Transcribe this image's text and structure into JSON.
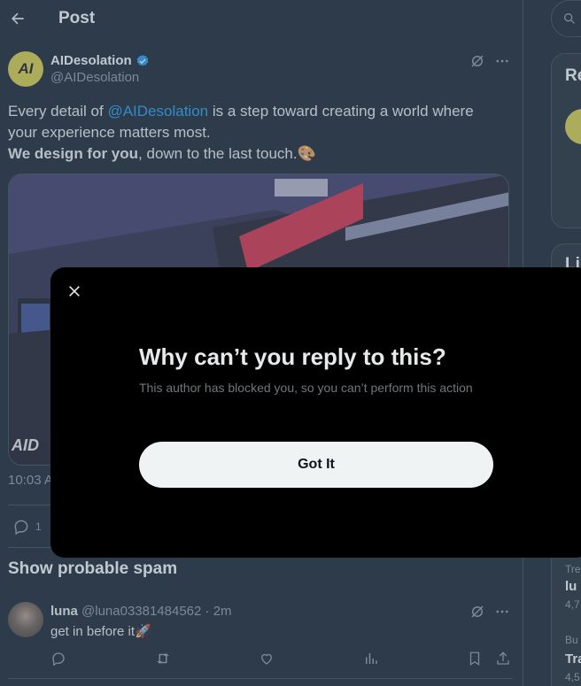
{
  "header": {
    "title": "Post"
  },
  "post": {
    "display_name": "AIDesolation",
    "handle": "@AIDesolation",
    "avatar_text": "AI",
    "text_prefix": "Every detail of ",
    "mention": "@AIDesolation",
    "text_middle": "  is a step toward creating a world where your experience matters most.",
    "bold_text": "We design for you",
    "text_suffix": ", down to the last touch.🎨",
    "media_logo_text": "AID",
    "time": "10:03 A",
    "reply_count": "1"
  },
  "spam_section": {
    "title": "Show probable spam"
  },
  "reply": {
    "name": "luna",
    "meta": " @luna03381484562 · 2m",
    "text": "get in before it🚀"
  },
  "right_sidebar": {
    "card1_title": "Re",
    "card2_title": "Li",
    "trend1_meta": "Tre",
    "trend1_name": "lu",
    "trend1_count": "4,7",
    "trend2_meta": "Bu",
    "trend2_name": "Tra",
    "trend2_count": "4,5"
  },
  "modal": {
    "title": "Why can’t you reply to this?",
    "description": "This author has blocked you, so you can’t perform this action",
    "button_label": "Got It"
  },
  "colors": {
    "accent": "#1d9bf0",
    "background": "#15202b",
    "modal": "#000000"
  }
}
